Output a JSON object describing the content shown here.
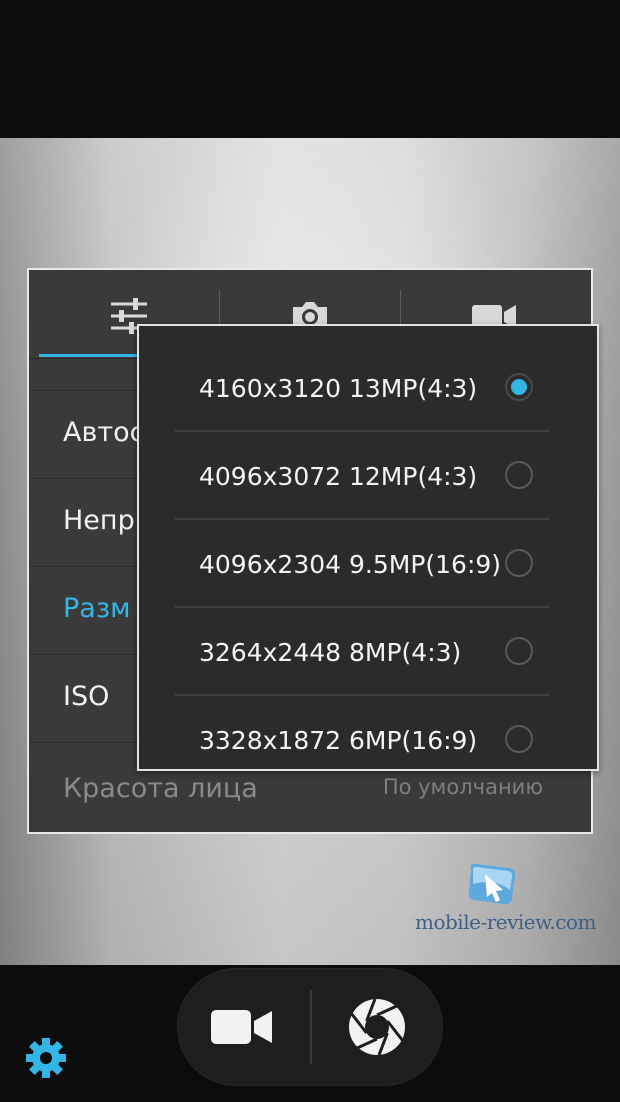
{
  "settings": {
    "rows": [
      {
        "label": "Автос"
      },
      {
        "label": "Непр"
      },
      {
        "label": "Разм"
      },
      {
        "label": "ISO"
      },
      {
        "label": "Красота лица",
        "value": "По умолчанию"
      }
    ],
    "tabs": [
      "sliders-icon",
      "camera-icon",
      "video-camera-icon"
    ]
  },
  "resolution_popup": {
    "options": [
      {
        "label": "4160x3120 13MP(4:3)",
        "selected": true
      },
      {
        "label": "4096x3072 12MP(4:3)",
        "selected": false
      },
      {
        "label": "4096x2304 9.5MP(16:9)",
        "selected": false
      },
      {
        "label": "3264x2448 8MP(4:3)",
        "selected": false
      },
      {
        "label": "3328x1872 6MP(16:9)",
        "selected": false
      }
    ]
  },
  "watermark": {
    "text": "mobile-review.com"
  },
  "colors": {
    "accent": "#33b5e5",
    "panel": "#3a3a3a",
    "popup": "#2b2b2b"
  },
  "bottom_bar": {
    "icons": [
      "video-camera-icon",
      "shutter-icon",
      "gear-icon"
    ]
  }
}
